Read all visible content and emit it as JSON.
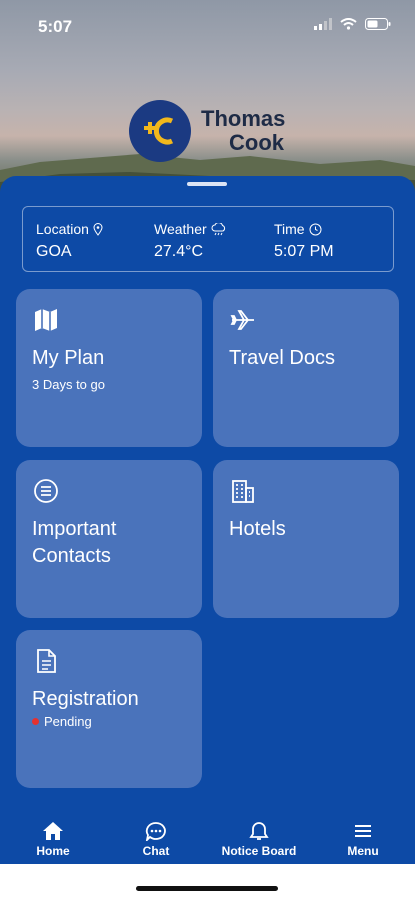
{
  "status_bar": {
    "time": "5:07"
  },
  "brand": {
    "line1": "Thomas",
    "line2": "Cook"
  },
  "info": {
    "location_label": "Location",
    "location_value": "GOA",
    "weather_label": "Weather",
    "weather_value": "27.4°C",
    "time_label": "Time",
    "time_value": "5:07 PM"
  },
  "cards": {
    "my_plan": {
      "title": "My Plan",
      "subtitle": "3 Days to go",
      "icon": "map-icon"
    },
    "travel_docs": {
      "title": "Travel Docs",
      "icon": "airplane-icon"
    },
    "important_contacts": {
      "title_line1": "Important",
      "title_line2": "Contacts",
      "icon": "list-icon"
    },
    "hotels": {
      "title": "Hotels",
      "icon": "building-icon"
    },
    "registration": {
      "title": "Registration",
      "status": "Pending",
      "status_color": "#e5312f",
      "icon": "document-icon"
    }
  },
  "nav": {
    "home": "Home",
    "chat": "Chat",
    "notice_board": "Notice Board",
    "menu": "Menu"
  },
  "colors": {
    "primary": "#0d4aa6",
    "card": "#4a73bb",
    "logo_yellow": "#f2b81c"
  }
}
